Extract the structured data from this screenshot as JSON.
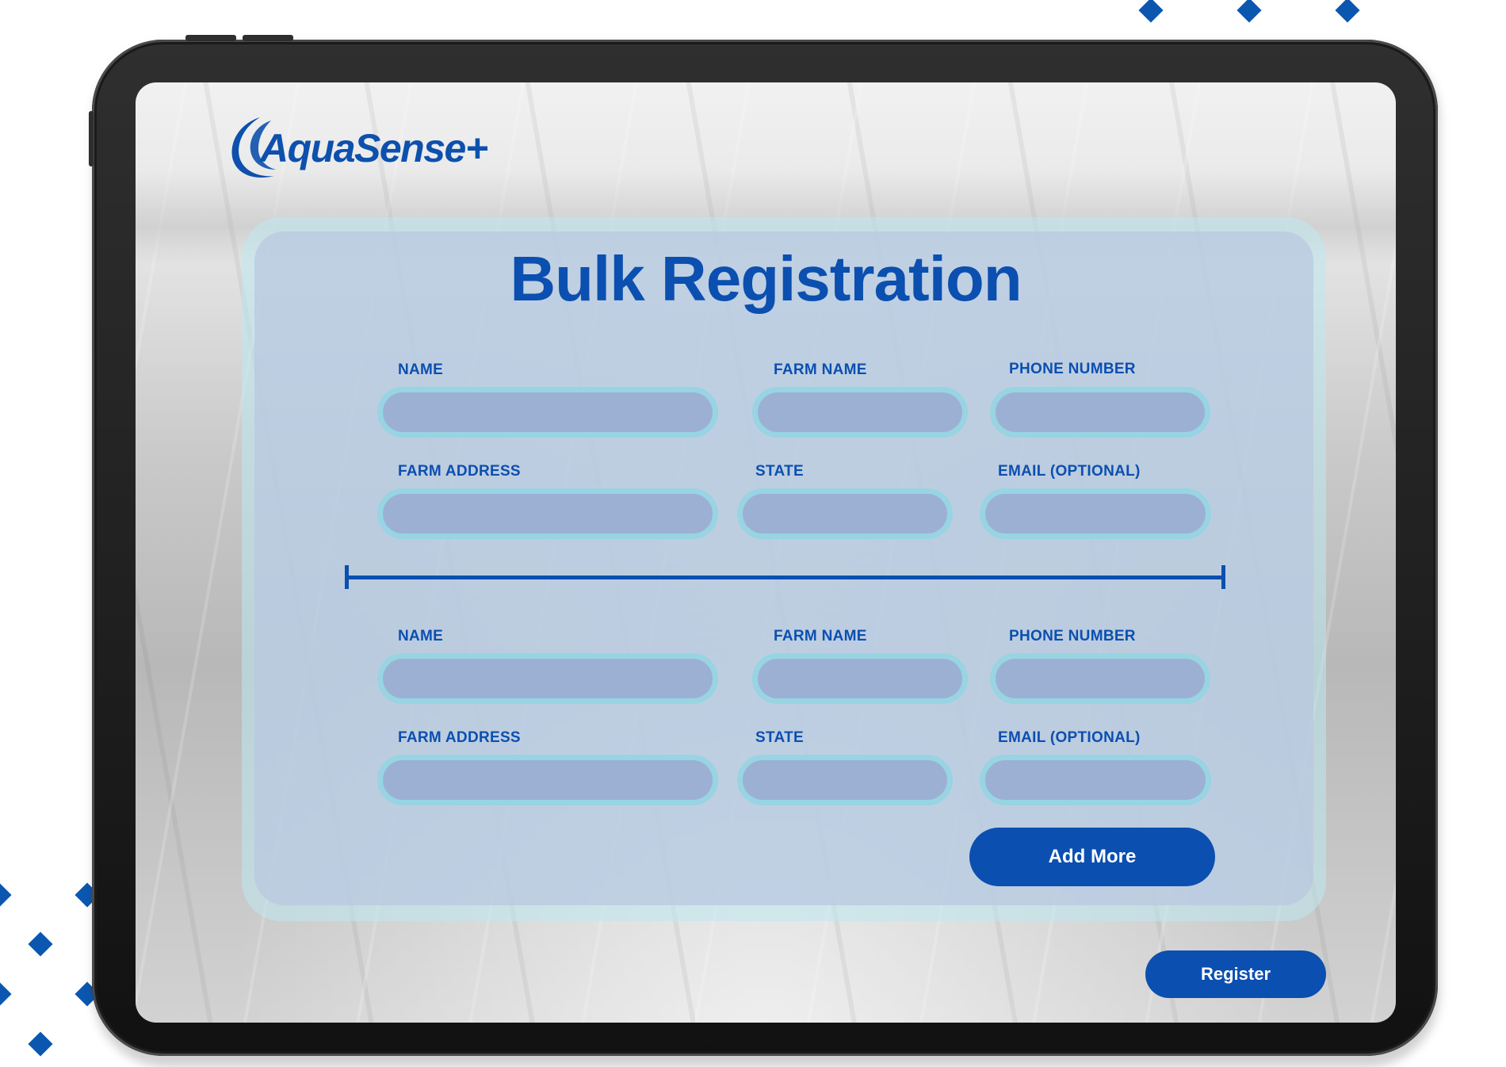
{
  "app": {
    "logo_text": "AquaSense+"
  },
  "form": {
    "title": "Bulk Registration",
    "entries": [
      {
        "name_label": "NAME",
        "farm_name_label": "FARM NAME",
        "phone_label": "PHONE NUMBER",
        "farm_address_label": "FARM ADDRESS",
        "state_label": "STATE",
        "email_label": "EMAIL (OPTIONAL)"
      },
      {
        "name_label": "NAME",
        "farm_name_label": "FARM NAME",
        "phone_label": "PHONE NUMBER",
        "farm_address_label": "FARM ADDRESS",
        "state_label": "STATE",
        "email_label": "EMAIL (OPTIONAL)"
      }
    ],
    "add_more_label": "Add More",
    "register_label": "Register"
  },
  "colors": {
    "brand_blue": "#0b4fb0",
    "field_fill": "#9cb0d4",
    "field_outline": "#96d4e2",
    "panel": "#bac8e0"
  }
}
